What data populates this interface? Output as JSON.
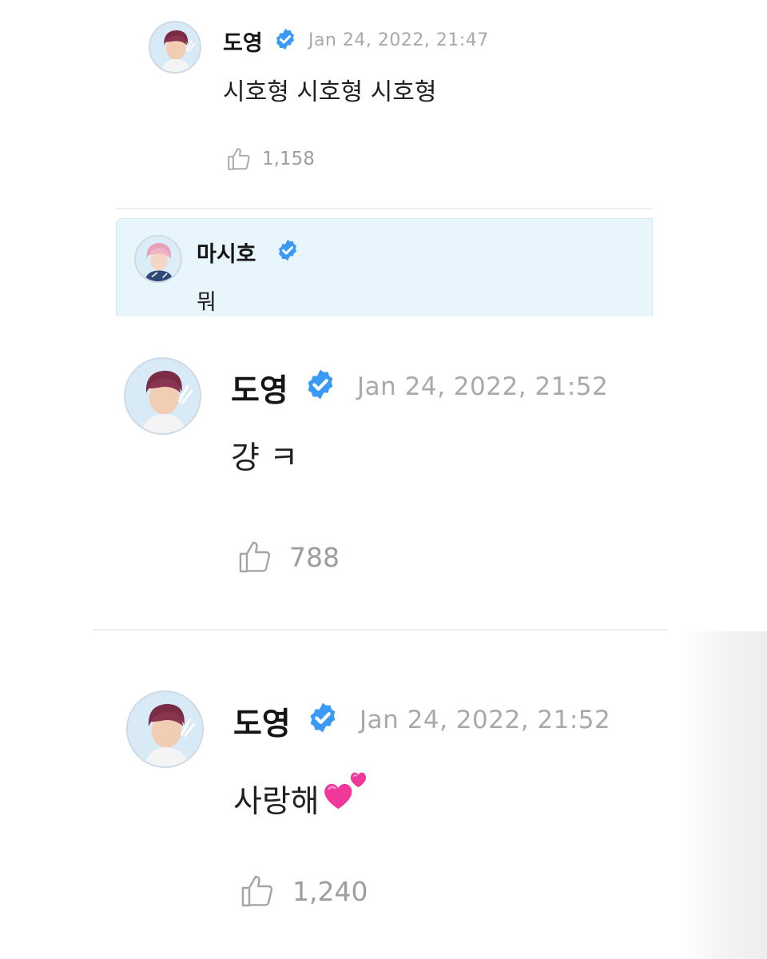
{
  "comments": [
    {
      "author": "도영",
      "verified": true,
      "timestamp": "Jan 24, 2022, 21:47",
      "text": "시호형 시호형 시호형",
      "likes": "1,158"
    },
    {
      "author": "도영",
      "verified": true,
      "timestamp": "Jan 24, 2022, 21:52",
      "text": "걍 ㅋ",
      "likes": "788",
      "quoted": {
        "author": "마시호",
        "verified": true,
        "text": "뭐"
      }
    },
    {
      "author": "도영",
      "verified": true,
      "timestamp": "Jan 24, 2022, 21:52",
      "text": "사랑해",
      "emoji": "two-hearts-emoji",
      "likes": "1,240"
    }
  ],
  "icons": {
    "verified": "verified-badge-icon",
    "like": "thumbs-up-icon"
  },
  "colors": {
    "verified_blue": "#3b9af5",
    "timestamp_gray": "#a6a9ae",
    "like_gray": "#9a9da2",
    "quote_background": "#e9f5fd",
    "heart_pink": "#f0389b"
  }
}
